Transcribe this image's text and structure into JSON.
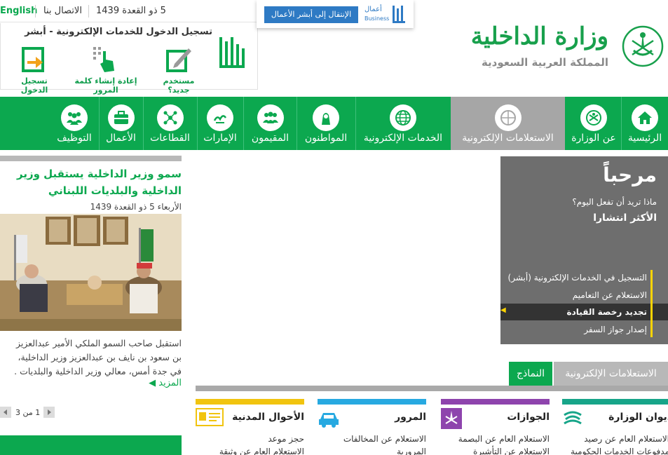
{
  "topbar": {
    "english_label": "English",
    "contact_label": "الاتصال بنا",
    "hijri_date": "5 ذو القعدة 1439"
  },
  "absher_login": {
    "title": "تسجيل الدخول للخدمات الإلكترونية - أبشر",
    "logo_text": "أبشر",
    "new_user_label": "مستخدم جديد؟",
    "reset_password_label": "إعادة إنشاء كلمة المرور",
    "login_label": "تسجيل الدخول"
  },
  "business": {
    "logo_text": "أعمال",
    "logo_sub": "Business",
    "button_label": "الإنتقال إلى أبشر الأعمال"
  },
  "header": {
    "ministry_name": "وزارة الداخلية",
    "kingdom_name": "المملكة العربية السعودية"
  },
  "nav": {
    "home": "الرئيسية",
    "about": "عن الوزارة",
    "inquiries": "الاستعلامات الإلكترونية",
    "eservices": "الخدمات الإلكترونية",
    "citizens": "المواطنون",
    "residents": "المقيمون",
    "emirates": "الإمارات",
    "sectors": "القطاعات",
    "business": "الأعمال",
    "employment": "التوظيف"
  },
  "news": {
    "title": "سمو وزير الداخلية يستقبل وزير الداخلية والبلديات اللبناني",
    "date": "الأربعاء 5 ذو القعدة 1439",
    "body_line1": "استقبل صاحب السمو الملكي الأمير عبدالعزيز",
    "body_line2": "بن سعود بن نايف بن عبدالعزيز وزير الداخلية،",
    "body_line3": "في جدة أمس، معالي وزير الداخلية والبلديات .",
    "more_label": "المزيد",
    "pager_text": "1 من 3"
  },
  "welcome": {
    "heading": "مرحباً",
    "question": "ماذا تريد أن تفعل اليوم؟",
    "popular_label": "الأكثر انتشارا",
    "links": [
      "التسجيل في الخدمات الإلكترونية (أبشر)",
      "الاستعلام عن التعاميم",
      "تجديد رخصة القيادة",
      "إصدار جواز السفر"
    ]
  },
  "tabs": {
    "services": "الاستعلامات الإلكترونية",
    "forms": "النماذج"
  },
  "categories": [
    {
      "name": "ديوان الوزارة",
      "color": "#17a589",
      "links": [
        "الاستعلام العام عن رصيد",
        "مدفوعات الخدمات الحكومية"
      ]
    },
    {
      "name": "الجوازات",
      "color": "#8e44ad",
      "links": [
        "الاستعلام العام عن البصمة",
        "الاستعلام عن التأشيرة"
      ]
    },
    {
      "name": "المرور",
      "color": "#27a9e1",
      "links": [
        "الاستعلام عن المخالفات",
        "المرورية"
      ]
    },
    {
      "name": "الأحوال المدنية",
      "color": "#f1c40f",
      "links": [
        "حجز موعد",
        "الاستعلام العام عن وثيقة"
      ]
    }
  ],
  "colors": {
    "brand_green": "#0ca84f",
    "active_nav": "#a6a6a6",
    "welcome_bg": "#6e6e6e",
    "accent_yellow": "#ffd400",
    "business_blue": "#2e7ac4"
  }
}
